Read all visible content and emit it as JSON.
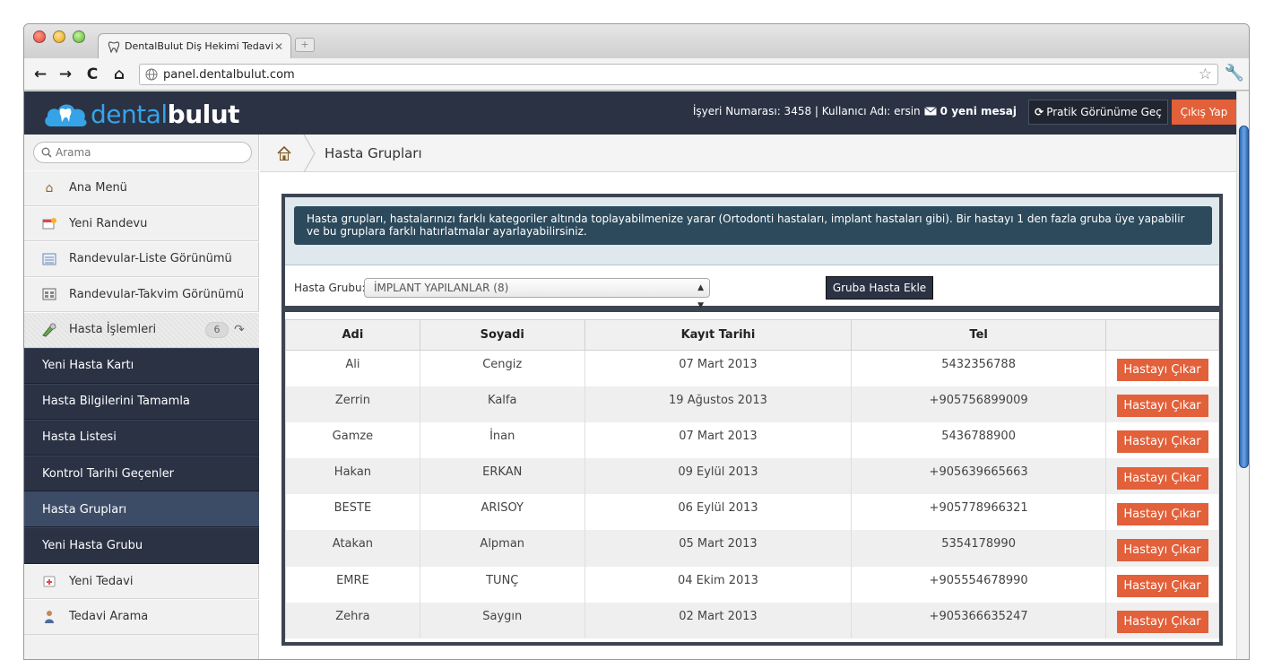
{
  "browser": {
    "tab_title": "DentalBulut Diş Hekimi Tedavi O",
    "url": "panel.dentalbulut.com"
  },
  "header": {
    "logo_light": "dental",
    "logo_bold": "bulut",
    "workplace_label": "İşyeri Numarası: 3458 | Kullanıcı Adı: ersin",
    "messages": "0 yeni mesaj",
    "pratik_label": "Pratik Görünüme Geç",
    "logout_label": "Çıkış Yap"
  },
  "sidebar": {
    "search_placeholder": "Arama",
    "items": [
      {
        "label": "Ana Menü",
        "icon": "home-icon"
      },
      {
        "label": "Yeni Randevu",
        "icon": "calendar-add-icon"
      },
      {
        "label": "Randevular-Liste Görünümü",
        "icon": "list-icon"
      },
      {
        "label": "Randevular-Takvim Görünümü",
        "icon": "calendar-icon"
      }
    ],
    "group": {
      "label": "Hasta İşlemleri",
      "badge": "6"
    },
    "subitems": [
      "Yeni Hasta Kartı",
      "Hasta Bilgilerini Tamamla",
      "Hasta Listesi",
      "Kontrol Tarihi Geçenler",
      "Hasta Grupları",
      "Yeni Hasta Grubu"
    ],
    "items_after": [
      {
        "label": "Yeni Tedavi",
        "icon": "treatment-icon"
      },
      {
        "label": "Tedavi Arama",
        "icon": "search-person-icon"
      }
    ]
  },
  "breadcrumb": {
    "title": "Hasta Grupları"
  },
  "panel": {
    "info": "Hasta grupları, hastalarınızı farklı kategoriler altında toplayabilmenize yarar (Ortodonti hastaları, implant hastaları gibi). Bir hastayı 1 den fazla gruba üye yapabilir ve bu gruplara farklı hatırlatmalar ayarlayabilirsiniz.",
    "filter_label": "Hasta Grubu:",
    "selected_group": "İMPLANT YAPILANLAR (8)",
    "add_button": "Gruba Hasta Ekle"
  },
  "table": {
    "headers": [
      "Adi",
      "Soyadi",
      "Kayıt Tarihi",
      "Tel",
      ""
    ],
    "remove_label": "Hastayı Çıkar",
    "rows": [
      [
        "Ali",
        "Cengiz",
        "07 Mart 2013",
        "5432356788"
      ],
      [
        "Zerrin",
        "Kalfa",
        "19 Ağustos 2013",
        "+905756899009"
      ],
      [
        "Gamze",
        "İnan",
        "07 Mart 2013",
        "5436788900"
      ],
      [
        "Hakan",
        "ERKAN",
        "09 Eylül 2013",
        "+905639665663"
      ],
      [
        "BESTE",
        "ARISOY",
        "06 Eylül 2013",
        "+905778966321"
      ],
      [
        "Atakan",
        "Alpman",
        "05 Mart 2013",
        "5354178990"
      ],
      [
        "EMRE",
        "TUNÇ",
        "04 Ekim 2013",
        "+905554678990"
      ],
      [
        "Zehra",
        "Saygın",
        "02 Mart 2013",
        "+905366635247"
      ]
    ]
  }
}
